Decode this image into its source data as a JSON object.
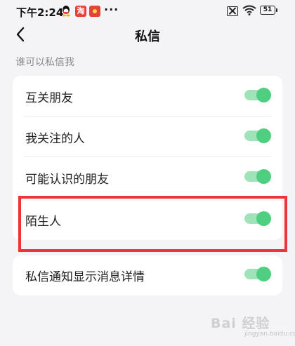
{
  "status_bar": {
    "time": "下午2:24",
    "icons": [
      "qq-icon",
      "taobao-icon",
      "red-packet-icon",
      "more-dots-icon",
      "sim-off-icon",
      "wifi-icon",
      "battery-icon"
    ],
    "taobao_glyph": "淘",
    "more_dots": "···",
    "battery_level": "51"
  },
  "nav": {
    "back_icon": "chevron-left-icon",
    "title": "私信"
  },
  "section": {
    "label": "谁可以私信我"
  },
  "settings": {
    "items": [
      {
        "label": "互关朋友",
        "enabled": true
      },
      {
        "label": "我关注的人",
        "enabled": true
      },
      {
        "label": "可能认识的朋友",
        "enabled": true
      },
      {
        "label": "陌生人",
        "enabled": true
      }
    ],
    "notify": {
      "label": "私信通知显示消息详情",
      "enabled": true
    }
  },
  "colors": {
    "toggle_on": "#4dcf7f",
    "toggle_track": "#9fe3b8",
    "highlight": "#ee3437",
    "background": "#f4f4f6"
  },
  "watermark": {
    "text": "Bai 经验",
    "sub": "jingyan.baidu.com"
  }
}
